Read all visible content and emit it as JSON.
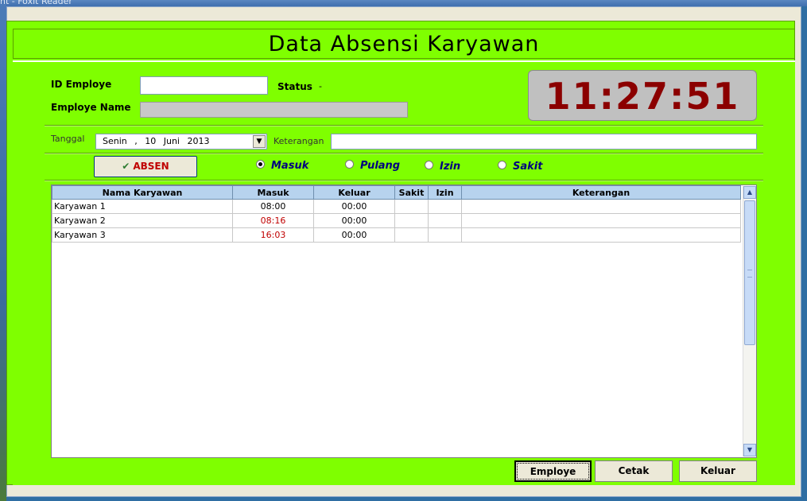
{
  "app": {
    "title_partial": "nt - Foxit Reader"
  },
  "header": {
    "title": "Data Absensi Karyawan"
  },
  "form": {
    "id_label": "ID Employe",
    "id_value": "",
    "name_label": "Employe Name",
    "name_value": "",
    "status_label": "Status",
    "status_value": "-",
    "tanggal_label": "Tanggal",
    "date_value": "Senin , 10   Juni   2013",
    "keterangan_label": "Keterangan",
    "keterangan_value": ""
  },
  "clock": {
    "time": "11:27:51"
  },
  "actions": {
    "absen_label": "ABSEN",
    "radios": [
      {
        "label": "Masuk",
        "checked": true
      },
      {
        "label": "Pulang",
        "checked": false
      },
      {
        "label": "Izin",
        "checked": false
      },
      {
        "label": "Sakit",
        "checked": false
      }
    ]
  },
  "table": {
    "columns": [
      "Nama Karyawan",
      "Masuk",
      "Keluar",
      "Sakit",
      "Izin",
      "Keterangan"
    ],
    "rows": [
      {
        "nama": "Karyawan 1",
        "masuk": "08:00",
        "masuk_late": false,
        "keluar": "00:00",
        "sakit": "",
        "izin": "",
        "keterangan": ""
      },
      {
        "nama": "Karyawan 2",
        "masuk": "08:16",
        "masuk_late": true,
        "keluar": "00:00",
        "sakit": "",
        "izin": "",
        "keterangan": ""
      },
      {
        "nama": "Karyawan 3",
        "masuk": "16:03",
        "masuk_late": true,
        "keluar": "00:00",
        "sakit": "",
        "izin": "",
        "keterangan": ""
      }
    ]
  },
  "footer": {
    "employe_label": "Employe",
    "cetak_label": "Cetak",
    "keluar_label": "Keluar"
  },
  "colors": {
    "form_bg": "#7fff00",
    "clock_text": "#8b0000",
    "late_time": "#c00000"
  }
}
